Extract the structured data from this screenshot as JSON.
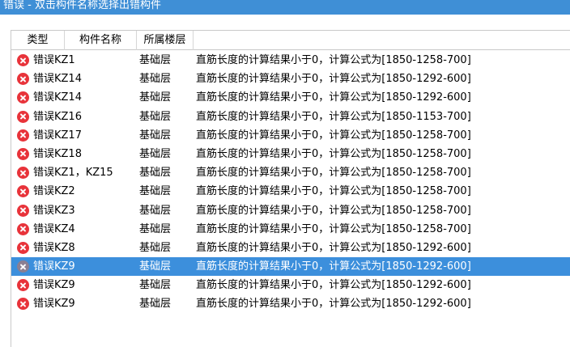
{
  "window": {
    "title": "错误 - 双击构件名称选择出错构件"
  },
  "table": {
    "columns": [
      "类型",
      "构件名称",
      "所属楼层"
    ],
    "selected_index": 11,
    "rows": [
      {
        "type": "错误",
        "name": "KZ1",
        "floor": "基础层",
        "message": "直筋长度的计算结果小于0，计算公式为[1850-1258-700]"
      },
      {
        "type": "错误",
        "name": "KZ14",
        "floor": "基础层",
        "message": "直筋长度的计算结果小于0，计算公式为[1850-1292-600]"
      },
      {
        "type": "错误",
        "name": "KZ14",
        "floor": "基础层",
        "message": "直筋长度的计算结果小于0，计算公式为[1850-1292-600]"
      },
      {
        "type": "错误",
        "name": "KZ16",
        "floor": "基础层",
        "message": "直筋长度的计算结果小于0，计算公式为[1850-1153-700]"
      },
      {
        "type": "错误",
        "name": "KZ17",
        "floor": "基础层",
        "message": "直筋长度的计算结果小于0，计算公式为[1850-1258-700]"
      },
      {
        "type": "错误",
        "name": "KZ18",
        "floor": "基础层",
        "message": "直筋长度的计算结果小于0，计算公式为[1850-1258-700]"
      },
      {
        "type": "错误",
        "name": "KZ1，KZ15",
        "floor": "基础层",
        "message": "直筋长度的计算结果小于0，计算公式为[1850-1258-700]"
      },
      {
        "type": "错误",
        "name": "KZ2",
        "floor": "基础层",
        "message": "直筋长度的计算结果小于0，计算公式为[1850-1258-700]"
      },
      {
        "type": "错误",
        "name": "KZ3",
        "floor": "基础层",
        "message": "直筋长度的计算结果小于0，计算公式为[1850-1258-700]"
      },
      {
        "type": "错误",
        "name": "KZ4",
        "floor": "基础层",
        "message": "直筋长度的计算结果小于0，计算公式为[1850-1258-700]"
      },
      {
        "type": "错误",
        "name": "KZ8",
        "floor": "基础层",
        "message": "直筋长度的计算结果小于0，计算公式为[1850-1292-600]"
      },
      {
        "type": "错误",
        "name": "KZ9",
        "floor": "基础层",
        "message": "直筋长度的计算结果小于0，计算公式为[1850-1292-600]"
      },
      {
        "type": "错误",
        "name": "KZ9",
        "floor": "基础层",
        "message": "直筋长度的计算结果小于0，计算公式为[1850-1292-600]"
      },
      {
        "type": "错误",
        "name": "KZ9",
        "floor": "基础层",
        "message": "直筋长度的计算结果小于0，计算公式为[1850-1292-600]"
      }
    ]
  },
  "colors": {
    "titlebar": "#3f8fd6",
    "selection": "#3c8fdc",
    "error_icon": "#e8333a"
  },
  "icons": {
    "row_icon": "error-icon"
  }
}
